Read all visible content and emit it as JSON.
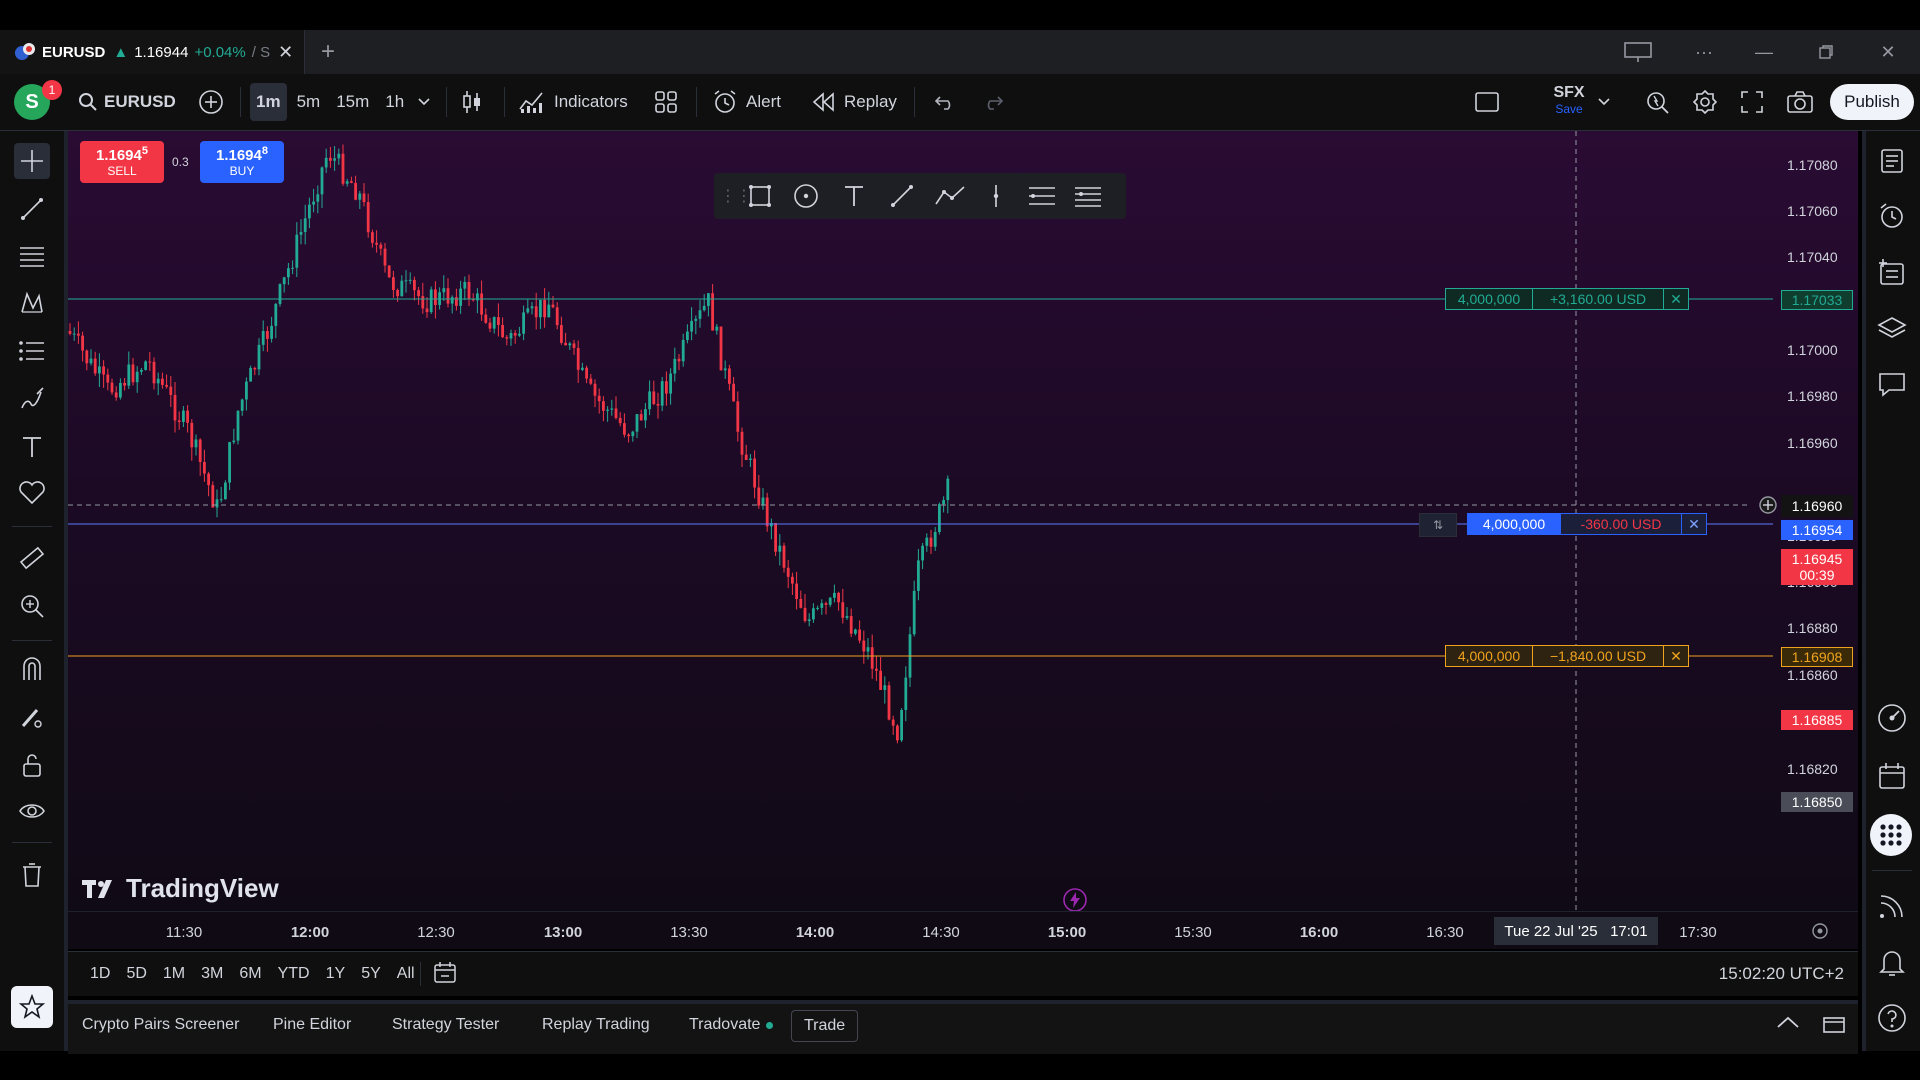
{
  "titlebar": {
    "tab_symbol": "EURUSD",
    "tab_arrow": "▲",
    "tab_price": "1.16944",
    "tab_change": "+0.04%",
    "tab_suffix": "/ S"
  },
  "toolbar": {
    "avatar_letter": "S",
    "notification_count": "1",
    "symbol": "EURUSD",
    "intervals": [
      "1m",
      "5m",
      "15m",
      "1h"
    ],
    "active_interval": "1m",
    "indicators_label": "Indicators",
    "alert_label": "Alert",
    "replay_label": "Replay",
    "layout_name": "SFX",
    "layout_status": "Save",
    "publish_label": "Publish"
  },
  "trade_widget": {
    "sell_price_main": "1.1694",
    "sell_price_sup": "5",
    "sell_label": "SELL",
    "spread": "0.3",
    "buy_price_main": "1.1694",
    "buy_price_sup": "8",
    "buy_label": "BUY"
  },
  "price_axis": {
    "ticks": [
      "1.17080",
      "1.17060",
      "1.17040",
      "1.17020",
      "1.17000",
      "1.16980",
      "1.16960",
      "1.16920",
      "1.16900",
      "1.16880",
      "1.16860",
      "1.16840",
      "1.16820"
    ],
    "badges": [
      {
        "text": "1.17033",
        "color": "#0f3d2e",
        "border": "#22ab94",
        "fg": "#22ab94"
      },
      {
        "text": "1.16954",
        "color": "#2962ff",
        "border": "#2962ff",
        "fg": "#ffffff"
      },
      {
        "text": "1.16945",
        "sub": "00:39",
        "color": "#f23645",
        "border": "#f23645",
        "fg": "#ffffff"
      },
      {
        "text": "1.16908",
        "color": "#3a2a08",
        "border": "#f0a31e",
        "fg": "#f0a31e"
      },
      {
        "text": "1.16885",
        "color": "#f23645",
        "border": "#f23645",
        "fg": "#ffffff"
      },
      {
        "text": "1.16850",
        "color": "#4a4d57",
        "border": "#4a4d57",
        "fg": "#ffffff"
      }
    ],
    "crosshair_price": "1.16960"
  },
  "positions": {
    "take_profit": {
      "qty": "4,000,000",
      "pnl": "+3,160.00 USD"
    },
    "entry": {
      "qty": "4,000,000",
      "pnl": "-360.00 USD"
    },
    "stop_loss": {
      "qty": "4,000,000",
      "pnl": "−1,840.00 USD"
    }
  },
  "time_axis": {
    "ticks": [
      "11:30",
      "12:00",
      "12:30",
      "13:00",
      "13:30",
      "14:00",
      "14:30",
      "15:00",
      "15:30",
      "16:00",
      "16:30",
      "17:30"
    ],
    "crosshair_label": "Tue 22 Jul '25   17:01"
  },
  "watermark": "TradingView",
  "range_bar": {
    "ranges": [
      "1D",
      "5D",
      "1M",
      "3M",
      "6M",
      "YTD",
      "1Y",
      "5Y",
      "All"
    ],
    "clock": "15:02:20 UTC+2"
  },
  "panels": {
    "items": [
      "Crypto Pairs Screener",
      "Pine Editor",
      "Strategy Tester",
      "Replay Trading",
      "Tradovate",
      "Trade"
    ]
  },
  "colors": {
    "up": "#22ab94",
    "down": "#f23645",
    "accent": "#2962ff",
    "stop": "#f0a31e"
  }
}
